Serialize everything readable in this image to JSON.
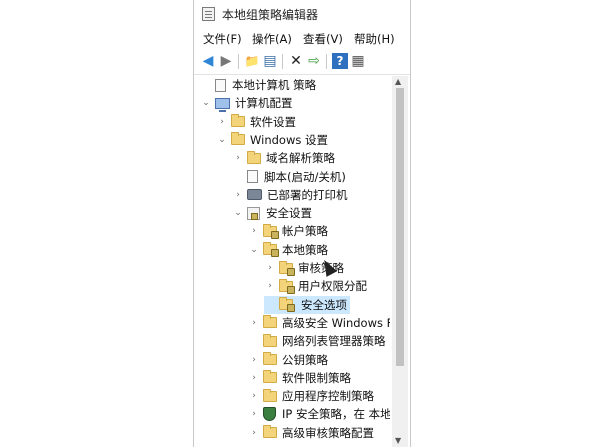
{
  "window": {
    "title": "本地组策略编辑器"
  },
  "menu": [
    "文件(F)",
    "操作(A)",
    "查看(V)",
    "帮助(H)"
  ],
  "toolbar": {
    "back": "◀",
    "forward": "▶",
    "up": "📁",
    "show_hide": "▤",
    "delete": "✕",
    "export": "⇨",
    "help": "?",
    "properties": "▦"
  },
  "tree": [
    {
      "label": "本地计算机 策略",
      "icon": "doc-icon",
      "arrow": ""
    },
    {
      "label": "计算机配置",
      "icon": "computer-icon",
      "arrow": "⌄"
    },
    {
      "label": "软件设置",
      "icon": "folder-icon",
      "arrow": "›"
    },
    {
      "label": "Windows 设置",
      "icon": "folder-icon",
      "arrow": "⌄"
    },
    {
      "label": "域名解析策略",
      "icon": "folder-icon",
      "arrow": "›"
    },
    {
      "label": "脚本(启动/关机)",
      "icon": "doc-icon",
      "arrow": ""
    },
    {
      "label": "已部署的打印机",
      "icon": "printer-icon",
      "arrow": "›"
    },
    {
      "label": "安全设置",
      "icon": "policy-icon",
      "arrow": "⌄"
    },
    {
      "label": "帐户策略",
      "icon": "folder-lock-icon",
      "arrow": "›"
    },
    {
      "label": "本地策略",
      "icon": "folder-lock-icon",
      "arrow": "⌄"
    },
    {
      "label": "审核策略",
      "icon": "folder-lock-icon",
      "arrow": "›"
    },
    {
      "label": "用户权限分配",
      "icon": "folder-lock-icon",
      "arrow": "›"
    },
    {
      "label": "安全选项",
      "icon": "folder-lock-icon",
      "arrow": "",
      "selected": true
    },
    {
      "label": "高级安全 Windows F",
      "icon": "folder-icon",
      "arrow": "›"
    },
    {
      "label": "网络列表管理器策略",
      "icon": "folder-icon",
      "arrow": ""
    },
    {
      "label": "公钥策略",
      "icon": "folder-icon",
      "arrow": "›"
    },
    {
      "label": "软件限制策略",
      "icon": "folder-icon",
      "arrow": "›"
    },
    {
      "label": "应用程序控制策略",
      "icon": "folder-icon",
      "arrow": "›"
    },
    {
      "label": "IP 安全策略，在 本地",
      "icon": "shield-icon",
      "arrow": "›"
    },
    {
      "label": "高级审核策略配置",
      "icon": "folder-icon",
      "arrow": "›"
    }
  ],
  "colors": {
    "selection": "#cce8ff",
    "folder": "#f4d47a"
  }
}
